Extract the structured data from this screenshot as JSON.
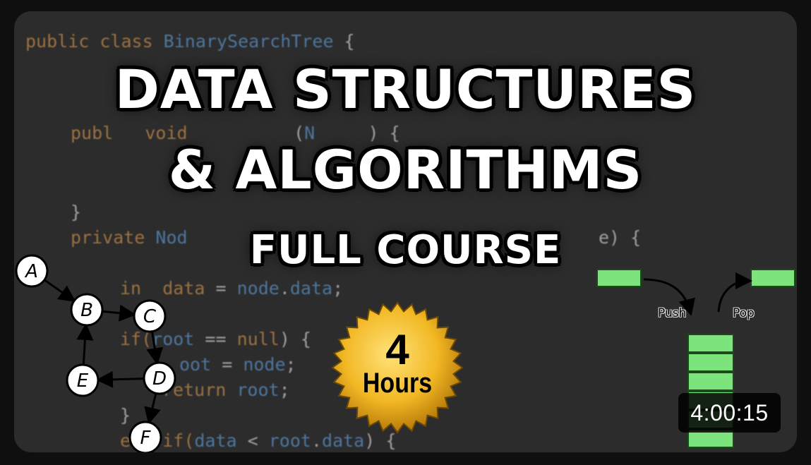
{
  "thumbnail": {
    "code_lines": [
      {
        "parts": [
          [
            "kw",
            "public class "
          ],
          [
            "ty",
            "BinarySearchTree"
          ],
          [
            "tx",
            " {"
          ]
        ]
      },
      {
        "parts": [
          [
            "kw",
            "publ"
          ],
          [
            "tx",
            "   "
          ],
          [
            "kw",
            "void"
          ],
          [
            "tx",
            "          ("
          ],
          [
            "ty",
            "N"
          ],
          [
            "tx",
            "     "
          ],
          [
            "tx",
            ") {"
          ]
        ]
      },
      {
        "parts": [
          [
            "tx",
            "}"
          ]
        ]
      },
      {
        "parts": [
          [
            "kw",
            "private "
          ],
          [
            "ty",
            "Nod"
          ]
        ]
      },
      {
        "parts": [
          [
            "tx",
            "e) {"
          ]
        ]
      },
      {
        "parts": [
          [
            "kw",
            "in"
          ],
          [
            "tx",
            "  "
          ],
          [
            "kw",
            "data"
          ],
          [
            "tx",
            " = "
          ],
          [
            "ty",
            "node"
          ],
          [
            "tx",
            "."
          ],
          [
            "ty",
            "data"
          ],
          [
            "tx",
            ";"
          ]
        ]
      },
      {
        "parts": [
          [
            "kw",
            "if("
          ],
          [
            "ty",
            "root"
          ],
          [
            "tx",
            " == "
          ],
          [
            "kw",
            "null"
          ],
          [
            "tx",
            ") {"
          ]
        ]
      },
      {
        "parts": [
          [
            "ty",
            "oot"
          ],
          [
            "tx",
            " = "
          ],
          [
            "ty",
            "node"
          ],
          [
            "tx",
            ";"
          ]
        ]
      },
      {
        "parts": [
          [
            "kw",
            "return "
          ],
          [
            "ty",
            "root"
          ],
          [
            "tx",
            ";"
          ]
        ]
      },
      {
        "parts": [
          [
            "tx",
            "}"
          ]
        ]
      },
      {
        "parts": [
          [
            "kw",
            "el"
          ],
          [
            "tx",
            "  "
          ],
          [
            "kw",
            "if("
          ],
          [
            "ty",
            "data"
          ],
          [
            "tx",
            " < "
          ],
          [
            "ty",
            "root"
          ],
          [
            "tx",
            "."
          ],
          [
            "ty",
            "data"
          ],
          [
            "tx",
            ") {"
          ]
        ]
      }
    ],
    "headline": {
      "line1": "DATA STRUCTURES",
      "line2": "& ALGORITHMS",
      "line3": "FULL COURSE"
    },
    "badge": {
      "number": "4",
      "label": "Hours"
    },
    "graph": {
      "nodes": [
        "A",
        "B",
        "C",
        "D",
        "E",
        "F"
      ],
      "edges": [
        [
          "A",
          "B"
        ],
        [
          "B",
          "C"
        ],
        [
          "C",
          "D"
        ],
        [
          "D",
          "E"
        ],
        [
          "E",
          "B"
        ],
        [
          "D",
          "F"
        ]
      ]
    },
    "stack": {
      "push_label": "Push",
      "pop_label": "Pop",
      "fill_color": "#7de47d"
    },
    "duration": "4:00:15"
  }
}
